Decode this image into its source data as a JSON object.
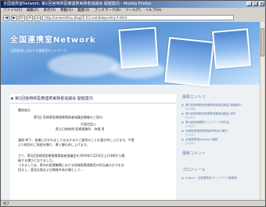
{
  "window": {
    "title": "全国連携室Network: 第1回宮崎県医療連携実務者協議会 開催案内 - Mozilla Firefox",
    "min": "_",
    "max": "□",
    "close": "×"
  },
  "menubar": [
    "ファイル(F)",
    "編集(E)",
    "表示(V)",
    "移動(G)",
    "履歴(S)",
    "ブックマーク(B)",
    "ツール(T)",
    "ヘルプ(H)"
  ],
  "toolbar": {
    "url": "http://renkeishitsu.blog55.fc2.com/blog-entry-4.html"
  },
  "header": {
    "site_title": "全国連携室Network",
    "site_sub": "全国各地に点在する連携室ネットワーク"
  },
  "article": {
    "title": "第1回宮崎県医療連携実務者協議会 開催案内",
    "lines": [
      "関係各位",
      "第1回 宮崎県医療連携実務者協議会開催のご案内",
      "代表世話人",
      "県立日南病院 医療連携科　持増 貴",
      "",
      "謹啓 時下、皆様におかれましてはますますご盛栄のことお喜び申し上げます。平素",
      "より格別のご高配を賜り、厚く御礼申し上げます。",
      "",
      "さて、第1回宮崎県医療連携実務者協議会を2009年1月24日(土)14時から開",
      "催する運びとなりました。",
      "つきましては、県内の医療機関における地域医療連携室の担当者の方々をお",
      "招きし、意見交換および情報共有の場として..."
    ]
  },
  "sidebar": {
    "recent_title": "最新エントリ",
    "recent": [
      {
        "label": "第1回宮崎県医療連携実務者協議会 開催案内",
        "date": "(01/08)"
      },
      {
        "label": "第1回宮崎県医療連携実務者協議会 案内",
        "date": "(01/07)"
      },
      {
        "label": "第4回医療連携ネットワーク研究会",
        "date": "(12/25)"
      },
      {
        "label": "地域医療連携実務者研修会の案内",
        "date": "(12/12)"
      },
      {
        "label": "全国連携室Network 開設",
        "date": "(12/01)"
      }
    ],
    "comments_title": "最新コメント",
    "profile_title": "プロフィール",
    "profile_text": "Author : 全国連携室ネットワーク事務局"
  },
  "status": "完了"
}
